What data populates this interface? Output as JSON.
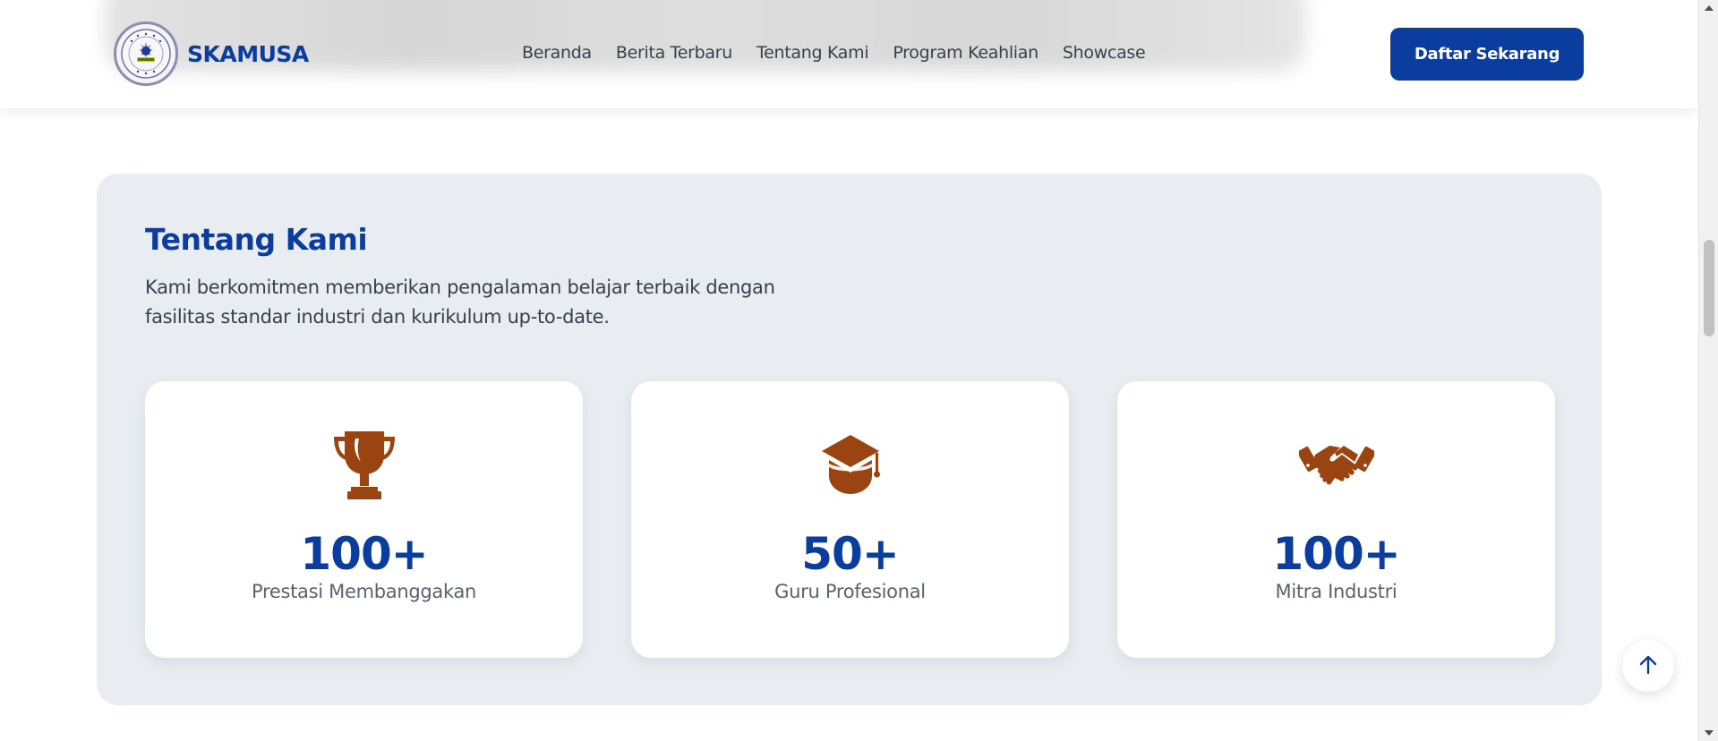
{
  "header": {
    "brand_name": "SKAMUSA",
    "logo_icon": "school-emblem-icon",
    "nav": [
      {
        "label": "Beranda"
      },
      {
        "label": "Berita Terbaru"
      },
      {
        "label": "Tentang Kami"
      },
      {
        "label": "Program Keahlian"
      },
      {
        "label": "Showcase"
      }
    ],
    "cta_label": "Daftar Sekarang"
  },
  "about": {
    "title": "Tentang Kami",
    "description_line1": "Kami berkomitmen memberikan pengalaman belajar terbaik dengan",
    "description_line2": "fasilitas standar industri dan kurikulum up-to-date.",
    "stats": [
      {
        "icon": "trophy-icon",
        "value": "100+",
        "label": "Prestasi Membanggakan"
      },
      {
        "icon": "graduation-cap-icon",
        "value": "50+",
        "label": "Guru Profesional"
      },
      {
        "icon": "handshake-icon",
        "value": "100+",
        "label": "Mitra Industri"
      }
    ]
  },
  "back_to_top_icon": "arrow-up-icon",
  "colors": {
    "brand_blue": "#0b3d9e",
    "icon_brown": "#9a4411",
    "section_bg": "#e9edf1",
    "text_gray": "#3a3f4a"
  }
}
